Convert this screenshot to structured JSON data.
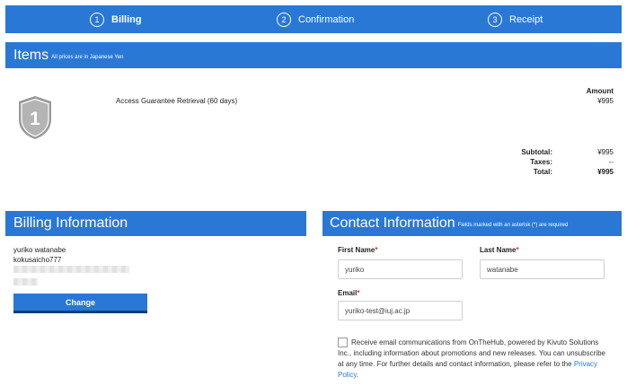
{
  "steps": [
    {
      "number": "1",
      "label": "Billing"
    },
    {
      "number": "2",
      "label": "Confirmation"
    },
    {
      "number": "3",
      "label": "Receipt"
    }
  ],
  "items": {
    "title": "Items",
    "subtitle": "All prices are in Japanese Yen",
    "badge_number": "1",
    "item_name": "Access Guarantee Retrieval (60 days)",
    "amount_header": "Amount",
    "amount_value": "¥995",
    "subtotal_label": "Subtotal:",
    "subtotal_value": "¥995",
    "taxes_label": "Taxes:",
    "taxes_value": "--",
    "total_label": "Total:",
    "total_value": "¥995"
  },
  "billing": {
    "title": "Billing Information",
    "name": "yuriko watanabe",
    "username": "kokusaicho777",
    "change_label": "Change"
  },
  "contact": {
    "title": "Contact Information",
    "subtitle": "Fields marked with an asterisk (*) are required",
    "first_name_label": "First Name",
    "first_name_value": "yuriko",
    "last_name_label": "Last Name",
    "last_name_value": "watanabe",
    "email_label": "Email",
    "email_value": "yuriko-test@iuj.ac.jp",
    "required_mark": "*",
    "consent_text": "Receive email communications from OnTheHub, powered by Kivuto Solutions Inc., including information about promotions and new releases. You can unsubscribe at any time. For further details and contact information, please refer to the ",
    "privacy_link": "Privacy Policy",
    "consent_end": "."
  },
  "colors": {
    "accent": "#2a78d6",
    "required": "#c0392b"
  }
}
